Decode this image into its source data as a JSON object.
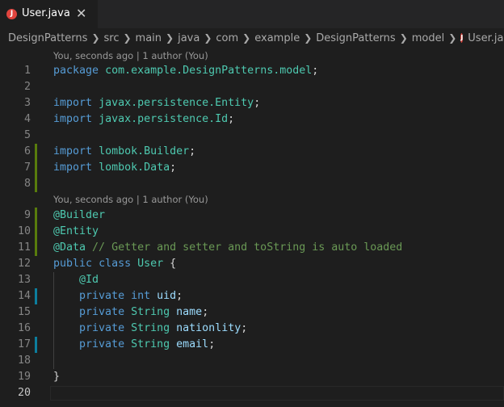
{
  "tab": {
    "icon_letter": "J",
    "label": "User.java",
    "close": "✕"
  },
  "breadcrumb": {
    "items": [
      "DesignPatterns",
      "src",
      "main",
      "java",
      "com",
      "example",
      "DesignPatterns",
      "model"
    ],
    "file_icon_letter": "J",
    "file": "User.java",
    "trailing": "..."
  },
  "codelens": {
    "top": "You, seconds ago | 1 author (You)",
    "class": "You, seconds ago | 1 author (You)"
  },
  "lines": [
    {
      "n": "1",
      "tokens": [
        [
          "kw",
          "package"
        ],
        [
          "pl",
          " "
        ],
        [
          "ty",
          "com.example.DesignPatterns.model"
        ],
        [
          "pl",
          ";"
        ]
      ]
    },
    {
      "n": "2",
      "tokens": []
    },
    {
      "n": "3",
      "tokens": [
        [
          "kw",
          "import"
        ],
        [
          "pl",
          " "
        ],
        [
          "ty",
          "javax.persistence.Entity"
        ],
        [
          "pl",
          ";"
        ]
      ]
    },
    {
      "n": "4",
      "tokens": [
        [
          "kw",
          "import"
        ],
        [
          "pl",
          " "
        ],
        [
          "ty",
          "javax.persistence.Id"
        ],
        [
          "pl",
          ";"
        ]
      ]
    },
    {
      "n": "5",
      "tokens": []
    },
    {
      "n": "6",
      "tokens": [
        [
          "kw",
          "import"
        ],
        [
          "pl",
          " "
        ],
        [
          "ty",
          "lombok.Builder"
        ],
        [
          "pl",
          ";"
        ]
      ]
    },
    {
      "n": "7",
      "tokens": [
        [
          "kw",
          "import"
        ],
        [
          "pl",
          " "
        ],
        [
          "ty",
          "lombok.Data"
        ],
        [
          "pl",
          ";"
        ]
      ]
    },
    {
      "n": "8",
      "tokens": []
    },
    {
      "n": "9",
      "tokens": [
        [
          "ty",
          "@Builder"
        ]
      ]
    },
    {
      "n": "10",
      "tokens": [
        [
          "ty",
          "@Entity"
        ]
      ]
    },
    {
      "n": "11",
      "tokens": [
        [
          "ty",
          "@Data"
        ],
        [
          "pl",
          " "
        ],
        [
          "cm",
          "// Getter and setter and toString is auto loaded"
        ]
      ]
    },
    {
      "n": "12",
      "tokens": [
        [
          "kw",
          "public"
        ],
        [
          "pl",
          " "
        ],
        [
          "kw",
          "class"
        ],
        [
          "pl",
          " "
        ],
        [
          "ty",
          "User"
        ],
        [
          "pl",
          " {"
        ]
      ]
    },
    {
      "n": "13",
      "tokens": [
        [
          "pl",
          "    "
        ],
        [
          "ty",
          "@Id"
        ]
      ]
    },
    {
      "n": "14",
      "tokens": [
        [
          "pl",
          "    "
        ],
        [
          "kw",
          "private"
        ],
        [
          "pl",
          " "
        ],
        [
          "kw",
          "int"
        ],
        [
          "pl",
          " "
        ],
        [
          "var",
          "uid"
        ],
        [
          "pl",
          ";"
        ]
      ]
    },
    {
      "n": "15",
      "tokens": [
        [
          "pl",
          "    "
        ],
        [
          "kw",
          "private"
        ],
        [
          "pl",
          " "
        ],
        [
          "ty",
          "String"
        ],
        [
          "pl",
          " "
        ],
        [
          "var",
          "name"
        ],
        [
          "pl",
          ";"
        ]
      ]
    },
    {
      "n": "16",
      "tokens": [
        [
          "pl",
          "    "
        ],
        [
          "kw",
          "private"
        ],
        [
          "pl",
          " "
        ],
        [
          "ty",
          "String"
        ],
        [
          "pl",
          " "
        ],
        [
          "var",
          "nationlity"
        ],
        [
          "pl",
          ";"
        ]
      ]
    },
    {
      "n": "17",
      "tokens": [
        [
          "pl",
          "    "
        ],
        [
          "kw",
          "private"
        ],
        [
          "pl",
          " "
        ],
        [
          "ty",
          "String"
        ],
        [
          "pl",
          " "
        ],
        [
          "var",
          "email"
        ],
        [
          "pl",
          ";"
        ]
      ]
    },
    {
      "n": "18",
      "tokens": []
    },
    {
      "n": "19",
      "tokens": [
        [
          "pl",
          "}"
        ]
      ]
    },
    {
      "n": "20",
      "tokens": []
    }
  ],
  "colors": {
    "keyword": "#569cd6",
    "type": "#4ec9b0",
    "variable": "#9cdcfe",
    "comment": "#6a9955",
    "git_added": "#587c0c",
    "git_modified": "#0c7d9d"
  }
}
